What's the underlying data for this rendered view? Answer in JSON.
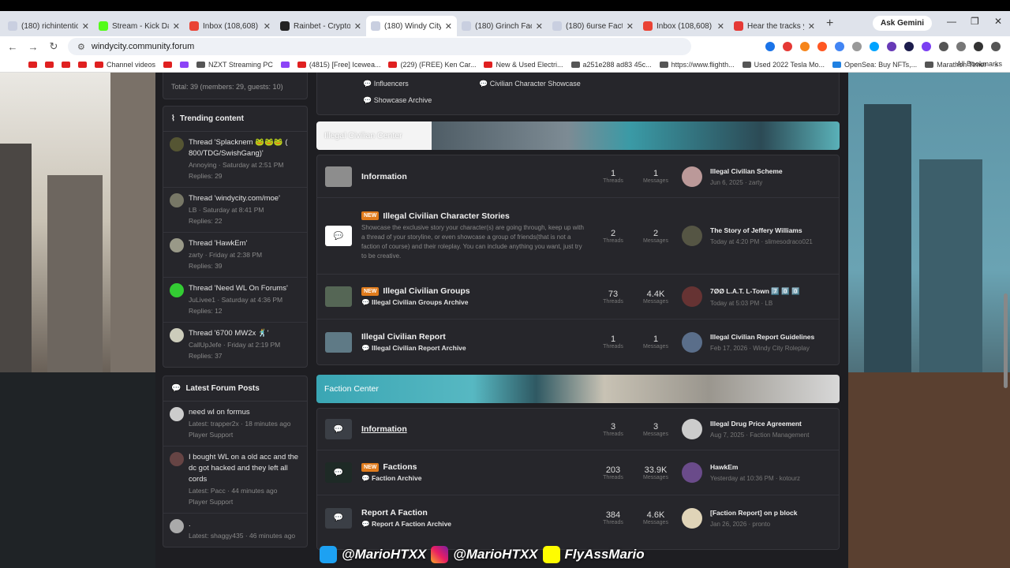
{
  "browser": {
    "tabs": [
      {
        "title": "(180) richintention",
        "active": false,
        "color": "#c9cfe0"
      },
      {
        "title": "Stream - Kick Dash",
        "active": false,
        "color": "#53fc18"
      },
      {
        "title": "Inbox (108,608) - G",
        "active": false,
        "color": "#ea4335"
      },
      {
        "title": "Rainbet - Crypto Ca",
        "active": false,
        "color": "#222222"
      },
      {
        "title": "(180) Windy City Ro",
        "active": true,
        "color": "#c9cfe0"
      },
      {
        "title": "(180) Grinch Factio",
        "active": false,
        "color": "#c9cfe0"
      },
      {
        "title": "(180) 6urse Faction",
        "active": false,
        "color": "#c9cfe0"
      },
      {
        "title": "Inbox (108,608) - G",
        "active": false,
        "color": "#ea4335"
      },
      {
        "title": "Hear the tracks you",
        "active": false,
        "color": "#e53935"
      }
    ],
    "ask_gemini": "Ask Gemini",
    "url": "windycity.community.forum",
    "bookmarks": [
      {
        "label": "",
        "type": "yt"
      },
      {
        "label": "",
        "type": "yt"
      },
      {
        "label": "",
        "type": "yt"
      },
      {
        "label": "",
        "type": "yt"
      },
      {
        "label": "Channel videos",
        "type": "yt"
      },
      {
        "label": "",
        "type": "yt"
      },
      {
        "label": "",
        "type": "tw"
      },
      {
        "label": "NZXT Streaming PC",
        "type": "gen"
      },
      {
        "label": "",
        "type": "tw"
      },
      {
        "label": "(4815) [Free] Icewea...",
        "type": "yt"
      },
      {
        "label": "(229) (FREE) Ken Car...",
        "type": "yt"
      },
      {
        "label": "New & Used Electri...",
        "type": "gen"
      },
      {
        "label": "a251e288 ad83 45c...",
        "type": "gen"
      },
      {
        "label": "https://www.flighth...",
        "type": "gen"
      },
      {
        "label": "Used 2022 Tesla Mo...",
        "type": "gen"
      },
      {
        "label": "OpenSea: Buy NFTs,...",
        "type": "gen"
      },
      {
        "label": "Marathon Timer",
        "type": "gen"
      }
    ],
    "all_bookmarks": "All Bookmarks"
  },
  "sidebar": {
    "online_total": "Total: 39 (members: 29, guests: 10)",
    "trending_title": "Trending content",
    "trending": [
      {
        "title": "Thread 'Splacknem 🐸🐸🐸 ( 800/TDG/SwishGang)'",
        "meta": "Annoying · Saturday at 2:51 PM",
        "replies": "Replies: 29"
      },
      {
        "title": "Thread 'windycity.com/moe'",
        "meta": "LB · Saturday at 8:41 PM",
        "replies": "Replies: 22"
      },
      {
        "title": "Thread 'HawkEm'",
        "meta": "zarty · Friday at 2:38 PM",
        "replies": "Replies: 39"
      },
      {
        "title": "Thread 'Need WL On Forums'",
        "meta": "JuLivee1 · Saturday at 4:36 PM",
        "replies": "Replies: 12"
      },
      {
        "title": "Thread '6700 MW2x 🕺'",
        "meta": "CallUpJefe · Friday at 2:19 PM",
        "replies": "Replies: 37"
      }
    ],
    "latest_title": "Latest Forum Posts",
    "latest": [
      {
        "title": "need wl on formus",
        "meta": "Latest: trapper2x · 18 minutes ago",
        "forum": "Player Support"
      },
      {
        "title": "I bought WL on a old acc and the dc got hacked and they left all cords",
        "meta": "Latest: Pacc · 44 minutes ago",
        "forum": "Player Support"
      },
      {
        "title": ".",
        "meta": "Latest: shaggy435 · 46 minutes ago",
        "forum": ""
      }
    ]
  },
  "main": {
    "top_links": [
      "Influencers",
      "Civilian Character Showcase",
      "Showcase Archive"
    ],
    "categories": [
      {
        "title": "Illegal Civilian Center",
        "forums": [
          {
            "title": "Information",
            "new": false,
            "sub": "",
            "desc": "",
            "threads": "1",
            "messages": "1",
            "last_title": "Illegal Civilian Scheme",
            "last_meta": "Jun 6, 2025 · zarty"
          },
          {
            "title": "Illegal Civilian Character Stories",
            "new": true,
            "sub": "",
            "desc": "Showcase the exclusive story your character(s) are going through, keep up with a thread of your storyline, or even showcase a group of friends(that is not a faction of course) and their roleplay. You can include anything you want, just try to be creative.",
            "threads": "2",
            "messages": "2",
            "last_title": "The Story of Jeffery Williams",
            "last_meta": "Today at 4:20 PM · slimesodraco021"
          },
          {
            "title": "Illegal Civilian Groups",
            "new": true,
            "sub": "Illegal Civilian Groups Archive",
            "desc": "",
            "threads": "73",
            "messages": "4.4K",
            "last_title": "7ØØ L.A.T. L-Town 7️⃣ 0️⃣ 0️⃣",
            "last_meta": "Today at 5:03 PM · LB"
          },
          {
            "title": "Illegal Civilian Report",
            "new": false,
            "sub": "Illegal Civilian Report Archive",
            "desc": "",
            "threads": "1",
            "messages": "1",
            "last_title": "Illegal Civilian Report Guidelines",
            "last_meta": "Feb 17, 2026 · Windy City Roleplay"
          }
        ]
      },
      {
        "title": "Faction Center",
        "forums": [
          {
            "title": "Information",
            "new": false,
            "sub": "",
            "desc": "",
            "threads": "3",
            "messages": "3",
            "last_title": "Illegal Drug Price Agreement",
            "last_meta": "Aug 7, 2025 · Faction Management"
          },
          {
            "title": "Factions",
            "new": true,
            "sub": "Faction Archive",
            "desc": "",
            "threads": "203",
            "messages": "33.9K",
            "last_title": "HawkEm",
            "last_meta": "Yesterday at 10:36 PM · kotourz"
          },
          {
            "title": "Report A Faction",
            "new": false,
            "sub": "Report A Faction Archive",
            "desc": "",
            "threads": "384",
            "messages": "4.6K",
            "last_title": "[Faction Report] on p block",
            "last_meta": "Jan 26, 2026 · pronto"
          }
        ]
      }
    ],
    "labels": {
      "threads": "Threads",
      "messages": "Messages",
      "new": "NEW"
    }
  },
  "overlay": {
    "twitter": "@MarioHTXX",
    "instagram": "@MarioHTXX",
    "snapchat": "FlyAssMario"
  }
}
